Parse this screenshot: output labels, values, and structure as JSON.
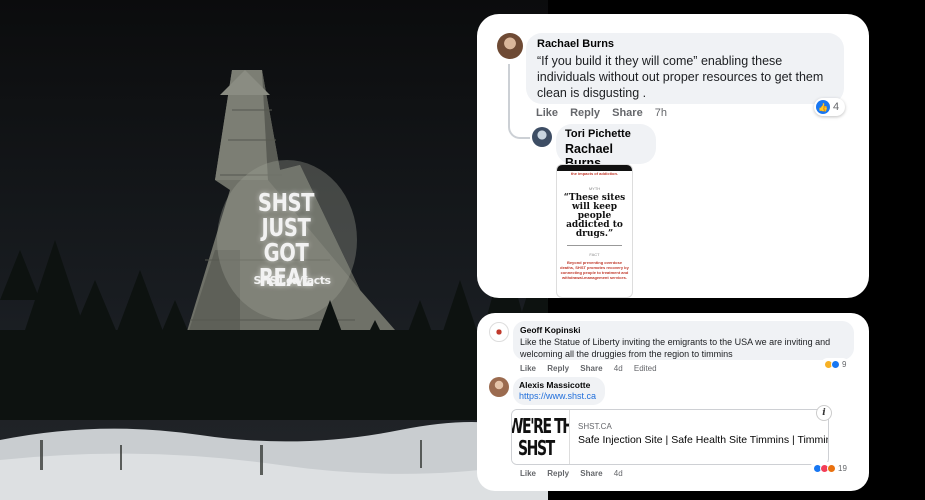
{
  "photo": {
    "projection_lines": [
      "SHST",
      "JUST GOT",
      "REAL"
    ],
    "projection_url": "SHST.ca/facts"
  },
  "comment1": {
    "author": "Rachael Burns",
    "text": "“If you build it they will come” enabling these individuals without out proper resources to get them clean is disgusting .",
    "actions": {
      "like": "Like",
      "reply": "Reply",
      "share": "Share",
      "time": "7h"
    },
    "reaction_count": "4"
  },
  "reply1": {
    "author": "Tori Pichette",
    "tag": "Rachael Burns",
    "image": {
      "top_text": "the impacts of addiction.",
      "myth_label": "MYTH",
      "quote": "“These sites will keep people addicted to drugs.”",
      "fact_label": "FACT",
      "body": "Beyond preventing overdose deaths, SHST promotes recovery by connecting people to treatment and withdrawal-management services."
    }
  },
  "comment2": {
    "author": "Geoff Kopinski",
    "text": "Like the Statue of Liberty inviting the emigrants to the USA we are inviting and welcoming all the druggies from the region to timmins",
    "actions": {
      "like": "Like",
      "reply": "Reply",
      "share": "Share",
      "time": "4d",
      "edited": "Edited"
    },
    "reaction_count": "9"
  },
  "comment3": {
    "author": "Alexis Massicotte",
    "link": "https://www.shst.ca",
    "preview": {
      "image_line1": "WE'RE THE",
      "image_line2": "SHST",
      "domain": "SHST.CA",
      "title": "Safe Injection Site | Safe Health Site Timmins | Timmins"
    },
    "actions": {
      "like": "Like",
      "reply": "Reply",
      "share": "Share",
      "time": "4d"
    },
    "reaction_count": "19"
  },
  "colors": {
    "facebook_blue": "#1877f2",
    "link_blue": "#216fdb",
    "bubble_grey": "#f0f2f5",
    "meta_grey": "#65676b"
  },
  "icons": {
    "like_reaction": "like-icon",
    "haha_reaction": "haha-icon",
    "angry_reaction": "angry-icon",
    "love_reaction": "love-icon",
    "info": "info-icon"
  }
}
